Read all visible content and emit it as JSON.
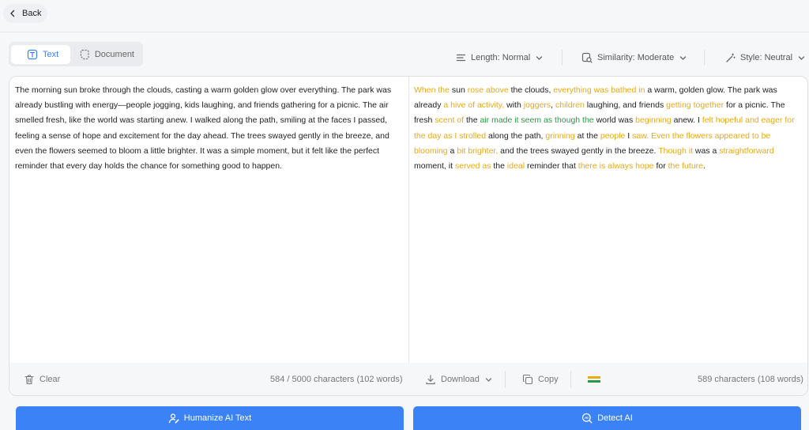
{
  "header": {
    "back_label": "Back"
  },
  "tabs": [
    {
      "label": "Text",
      "icon": "text-icon",
      "active": true
    },
    {
      "label": "Document",
      "icon": "document-icon",
      "active": false
    }
  ],
  "options": {
    "length": "Length: Normal",
    "similarity": "Similarity: Moderate",
    "style": "Style: Neutral"
  },
  "input": {
    "text": "The morning sun broke through the clouds, casting a warm golden glow over everything. The park was already bustling with energy—people jogging, kids laughing, and friends gathering for a picnic. The air smelled fresh, like the world was starting anew. I walked along the path, smiling at the faces I passed, feeling a sense of hope and excitement for the day ahead. The trees swayed gently in the breeze, and even the flowers seemed to bloom a little brighter. It was a simple moment, but it felt like the perfect reminder that every day holds the chance for something good to happen.",
    "clear_label": "Clear",
    "char_count": "584 / 5000 characters (102 words)"
  },
  "output": {
    "segments": [
      {
        "t": "When the",
        "c": "y"
      },
      {
        "t": " sun ",
        "c": ""
      },
      {
        "t": "rose above",
        "c": "y"
      },
      {
        "t": " the clouds, ",
        "c": ""
      },
      {
        "t": "everything was bathed in",
        "c": "y"
      },
      {
        "t": " a warm, golden glow. The park was already ",
        "c": ""
      },
      {
        "t": "a hive of activity,",
        "c": "y"
      },
      {
        "t": " with ",
        "c": ""
      },
      {
        "t": "joggers",
        "c": "y"
      },
      {
        "t": ", ",
        "c": ""
      },
      {
        "t": "children",
        "c": "y"
      },
      {
        "t": " laughing, and friends ",
        "c": ""
      },
      {
        "t": "getting together",
        "c": "y"
      },
      {
        "t": " for a picnic. The fresh ",
        "c": ""
      },
      {
        "t": "scent of",
        "c": "y"
      },
      {
        "t": " the ",
        "c": ""
      },
      {
        "t": "air made it seem as though the",
        "c": "g"
      },
      {
        "t": " world was ",
        "c": ""
      },
      {
        "t": "beginning",
        "c": "y"
      },
      {
        "t": " anew. I ",
        "c": ""
      },
      {
        "t": "felt hopeful and eager for the day as I strolled",
        "c": "y"
      },
      {
        "t": " along the path, ",
        "c": ""
      },
      {
        "t": "grinning",
        "c": "y"
      },
      {
        "t": " at the ",
        "c": ""
      },
      {
        "t": "people",
        "c": "y"
      },
      {
        "t": " I ",
        "c": ""
      },
      {
        "t": "saw. Even the flowers appeared to be blooming",
        "c": "y"
      },
      {
        "t": " a ",
        "c": ""
      },
      {
        "t": "bit brighter,",
        "c": "y"
      },
      {
        "t": " and the trees swayed gently in the breeze. ",
        "c": ""
      },
      {
        "t": "Though it",
        "c": "y"
      },
      {
        "t": " was a ",
        "c": ""
      },
      {
        "t": "straightforward",
        "c": "y"
      },
      {
        "t": " moment, it ",
        "c": ""
      },
      {
        "t": "served as",
        "c": "y"
      },
      {
        "t": " the ",
        "c": ""
      },
      {
        "t": "ideal",
        "c": "y"
      },
      {
        "t": " reminder that ",
        "c": ""
      },
      {
        "t": "there is always hope",
        "c": "y"
      },
      {
        "t": " for ",
        "c": ""
      },
      {
        "t": "the future",
        "c": "y"
      },
      {
        "t": ".",
        "c": ""
      }
    ],
    "download_label": "Download",
    "copy_label": "Copy",
    "char_count": "589 characters (108 words)"
  },
  "actions": {
    "humanize_label": "Humanize AI Text",
    "detect_label": "Detect AI"
  },
  "colors": {
    "accent": "#3b82f6",
    "highlight_yellow": "#e8a916",
    "highlight_green": "#2b9a47"
  }
}
